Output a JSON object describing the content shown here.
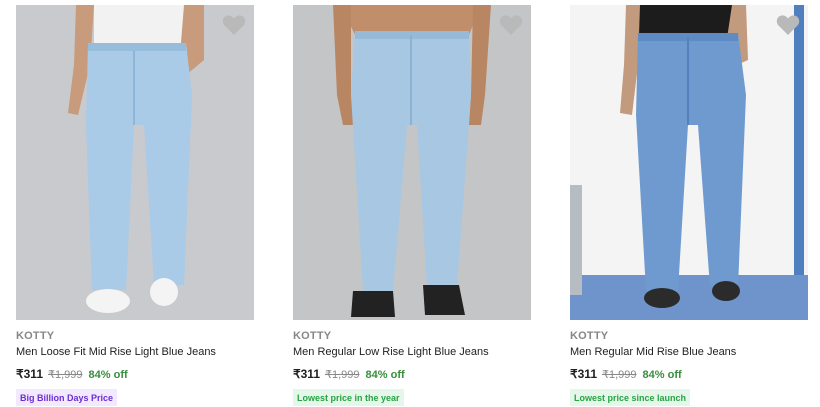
{
  "products": [
    {
      "brand": "KOTTY",
      "title": "Men Loose Fit Mid Rise Light Blue Jeans",
      "price": "₹311",
      "mrp": "₹1,999",
      "discount": "84% off",
      "badge": "Big Billion Days Price",
      "image_icon": "jeans-product-image",
      "wishlist_icon": "heart-icon"
    },
    {
      "brand": "KOTTY",
      "title": "Men Regular Low Rise Light Blue Jeans",
      "price": "₹311",
      "mrp": "₹1,999",
      "discount": "84% off",
      "badge": "Lowest price in the year",
      "image_icon": "jeans-product-image",
      "wishlist_icon": "heart-icon"
    },
    {
      "brand": "KOTTY",
      "title": "Men Regular Mid Rise Blue Jeans",
      "price": "₹311",
      "mrp": "₹1,999",
      "discount": "84% off",
      "badge": "Lowest price since launch",
      "image_icon": "jeans-product-image",
      "wishlist_icon": "heart-icon"
    }
  ],
  "colors": {
    "discount": "#388e3c",
    "badge_purple_text": "#6b2fd1",
    "badge_green_text": "#26a541",
    "wishlist_heart": "#b9b9b9"
  }
}
